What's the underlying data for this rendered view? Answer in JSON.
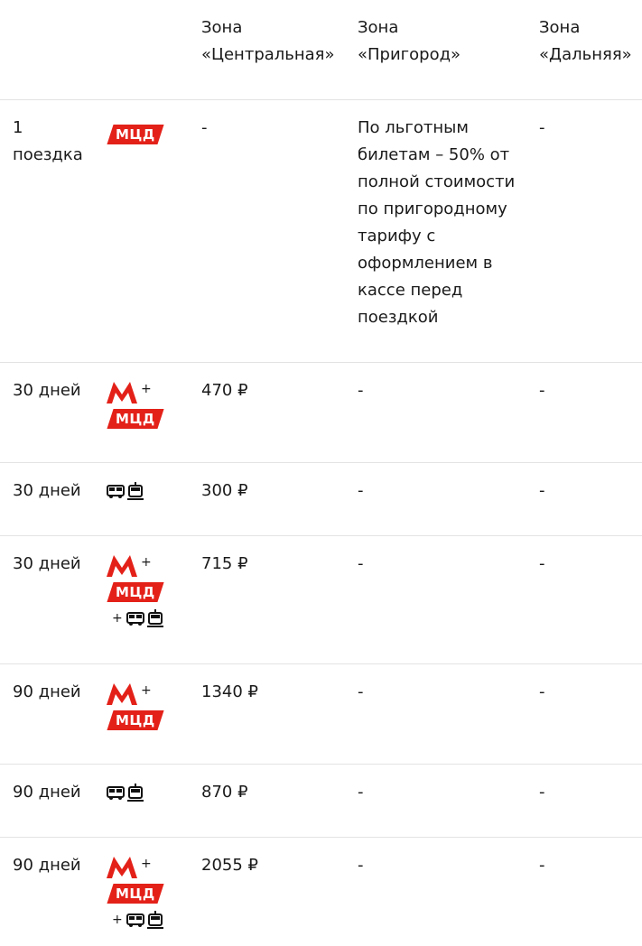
{
  "header": {
    "col3": [
      "Зона",
      "«Центральная»"
    ],
    "col4": [
      "Зона",
      "«Пригород»"
    ],
    "col5": [
      "Зона",
      "«Дальняя»"
    ]
  },
  "icons": {
    "mcd_label": "МЦД",
    "plus": "+",
    "metro": "metro-icon",
    "bus": "bus-icon",
    "tram": "tram-icon"
  },
  "colors": {
    "metro_red": "#e32119",
    "divider": "#e3e3e3"
  },
  "rows": [
    {
      "period": "1 поездка",
      "central": "-",
      "suburb": "По льготным билетам – 50% от полной стоимости по пригородному тарифу с оформлением в кассе перед поездкой",
      "far": "-"
    },
    {
      "period": "30 дней",
      "central": "470 ₽",
      "suburb": "-",
      "far": "-"
    },
    {
      "period": "30 дней",
      "central": "300 ₽",
      "suburb": "-",
      "far": "-"
    },
    {
      "period": "30 дней",
      "central": "715 ₽",
      "suburb": "-",
      "far": "-"
    },
    {
      "period": "90 дней",
      "central": "1340 ₽",
      "suburb": "-",
      "far": "-"
    },
    {
      "period": "90 дней",
      "central": "870 ₽",
      "suburb": "-",
      "far": "-"
    },
    {
      "period": "90 дней",
      "central": "2055 ₽",
      "suburb": "-",
      "far": "-"
    }
  ]
}
